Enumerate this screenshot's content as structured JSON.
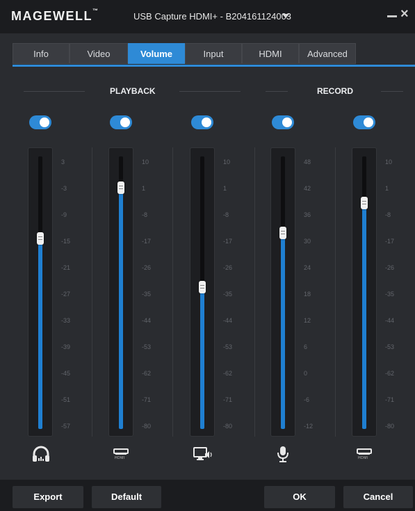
{
  "app": {
    "logo": "MAGEWELL",
    "logo_tm": "™",
    "device_name": "USB Capture HDMI+ - B204161124003"
  },
  "tabs": [
    {
      "label": "Info",
      "active": false
    },
    {
      "label": "Video",
      "active": false
    },
    {
      "label": "Volume",
      "active": true
    },
    {
      "label": "Input",
      "active": false
    },
    {
      "label": "HDMI",
      "active": false
    },
    {
      "label": "Advanced",
      "active": false
    }
  ],
  "sections": {
    "playback": "PLAYBACK",
    "record": "RECORD"
  },
  "channels": [
    {
      "icon": "headphones-icon",
      "enabled": true,
      "level": 0.7,
      "ticks": [
        "3",
        "-3",
        "-9",
        "-15",
        "-21",
        "-27",
        "-33",
        "-39",
        "-45",
        "-51",
        "-57"
      ]
    },
    {
      "icon": "hdmi-icon",
      "enabled": true,
      "level": 0.885,
      "ticks": [
        "10",
        "1",
        "-8",
        "-17",
        "-26",
        "-35",
        "-44",
        "-53",
        "-62",
        "-71",
        "-80"
      ]
    },
    {
      "icon": "computer-speaker-icon",
      "enabled": true,
      "level": 0.52,
      "ticks": [
        "10",
        "1",
        "-8",
        "-17",
        "-26",
        "-35",
        "-44",
        "-53",
        "-62",
        "-71",
        "-80"
      ]
    },
    {
      "icon": "microphone-icon",
      "enabled": true,
      "level": 0.72,
      "ticks": [
        "48",
        "42",
        "36",
        "30",
        "24",
        "18",
        "12",
        "6",
        "0",
        "-6",
        "-12"
      ]
    },
    {
      "icon": "hdmi-icon",
      "enabled": true,
      "level": 0.83,
      "ticks": [
        "10",
        "1",
        "-8",
        "-17",
        "-26",
        "-35",
        "-44",
        "-53",
        "-62",
        "-71",
        "-80"
      ]
    }
  ],
  "icon_text": {
    "hdmi": "HDMI"
  },
  "footer": {
    "export": "Export",
    "default": "Default",
    "ok": "OK",
    "cancel": "Cancel"
  },
  "colors": {
    "accent": "#2e8ad6",
    "fill": "#1f7fd1",
    "background": "#2a2c30"
  }
}
